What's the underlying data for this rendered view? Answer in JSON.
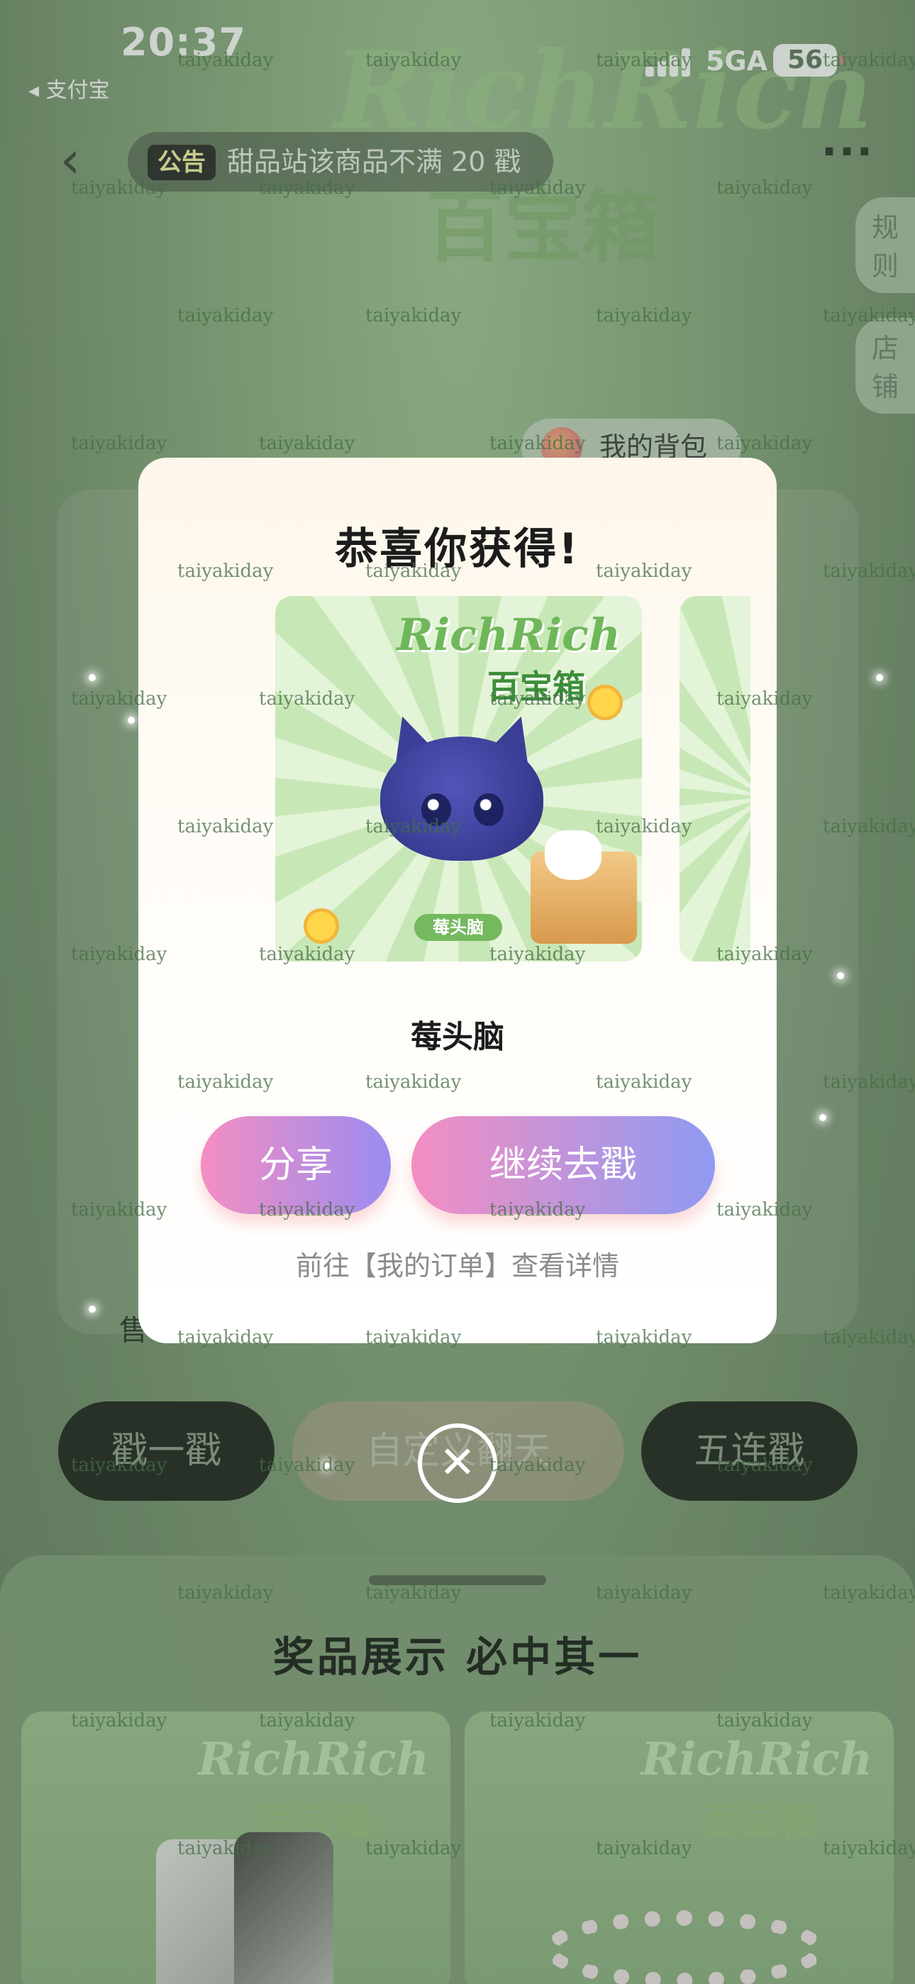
{
  "status_bar": {
    "time": "20:37",
    "back_app": "◂ 支付宝",
    "network": "5GA",
    "battery": "56"
  },
  "header": {
    "back_icon": "chevron-left-icon",
    "announcement_tag": "公告",
    "announcement_text": "甜品站该商品不满 20 戳",
    "more_icon": "more-horizontal-icon"
  },
  "side_tabs": {
    "rules": "规则",
    "store": "店铺"
  },
  "hero": {
    "brand": "RichRich",
    "subtitle": "百宝箱",
    "backpack_label": "我的背包"
  },
  "modal": {
    "title": "恭喜你获得!",
    "prize_brand": "RichRich",
    "prize_brand_sub": "百宝箱",
    "prize_tag": "莓头脑",
    "prize_name": "莓头脑",
    "share_label": "分享",
    "continue_label": "继续去戳",
    "order_hint": "前往【我的订单】查看详情"
  },
  "background_actions": {
    "sale_label": "售",
    "single_label": "戳一戳",
    "custom_label": "自定义翻天",
    "five_label": "五连戳"
  },
  "bottom_sheet": {
    "title": "奖品展示 必中其一",
    "card_brand": "RichRich",
    "card_brand_sub": "百宝箱"
  },
  "watermark": "taiyakiday",
  "colors": {
    "accent_pink": "#f48ec2",
    "accent_purple": "#8e9af2",
    "bg_green": "#86a97c"
  }
}
